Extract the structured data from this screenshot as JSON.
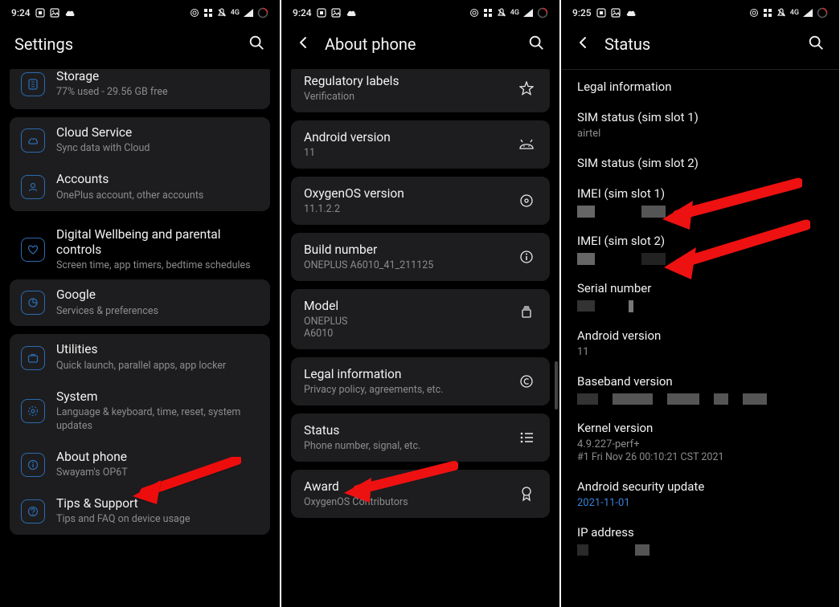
{
  "status": {
    "time_a": "9:24",
    "time_b": "9:24",
    "time_c": "9:25",
    "net": "4G"
  },
  "panel1": {
    "title": "Settings",
    "storage": {
      "title": "Storage",
      "sub": "77% used - 29.56 GB free"
    },
    "cloud": {
      "title": "Cloud Service",
      "sub": "Sync data with Cloud"
    },
    "accounts": {
      "title": "Accounts",
      "sub": "OnePlus account, other accounts"
    },
    "dwb": {
      "title": "Digital Wellbeing and parental controls",
      "sub": "Screen time, app timers, bedtime schedules"
    },
    "google": {
      "title": "Google",
      "sub": "Services & preferences"
    },
    "utilities": {
      "title": "Utilities",
      "sub": "Quick launch, parallel apps, app locker"
    },
    "system": {
      "title": "System",
      "sub": "Language & keyboard, time, reset, system updates"
    },
    "about": {
      "title": "About phone",
      "sub": "Swayam's OP6T"
    },
    "tips": {
      "title": "Tips & Support",
      "sub": "Tips and FAQ on device usage"
    }
  },
  "panel2": {
    "title": "About phone",
    "reg": {
      "title": "Regulatory labels",
      "sub": "Verification"
    },
    "android": {
      "title": "Android version",
      "sub": "11"
    },
    "oxygen": {
      "title": "OxygenOS version",
      "sub": "11.1.2.2"
    },
    "build": {
      "title": "Build number",
      "sub": "ONEPLUS A6010_41_211125"
    },
    "model": {
      "title": "Model",
      "sub": "ONEPLUS",
      "sub2": "A6010"
    },
    "legal": {
      "title": "Legal information",
      "sub": "Privacy policy, agreements, etc."
    },
    "status": {
      "title": "Status",
      "sub": "Phone number, signal, etc."
    },
    "award": {
      "title": "Award",
      "sub": "OxygenOS Contributors"
    }
  },
  "panel3": {
    "title": "Status",
    "legal": "Legal information",
    "sim1": {
      "title": "SIM status (sim slot 1)",
      "sub": "airtel"
    },
    "sim2": {
      "title": "SIM status (sim slot 2)"
    },
    "imei1": {
      "title": "IMEI (sim slot 1)"
    },
    "imei2": {
      "title": "IMEI (sim slot 2)"
    },
    "serial": {
      "title": "Serial number"
    },
    "android": {
      "title": "Android version",
      "sub": "11"
    },
    "baseband": {
      "title": "Baseband version"
    },
    "kernel": {
      "title": "Kernel version",
      "sub": "4.9.227-perf+",
      "sub2": "#1 Fri Nov 26 00:10:21 CST 2021"
    },
    "security": {
      "title": "Android security update",
      "sub": "2021-11-01"
    },
    "ip": {
      "title": "IP address"
    }
  }
}
